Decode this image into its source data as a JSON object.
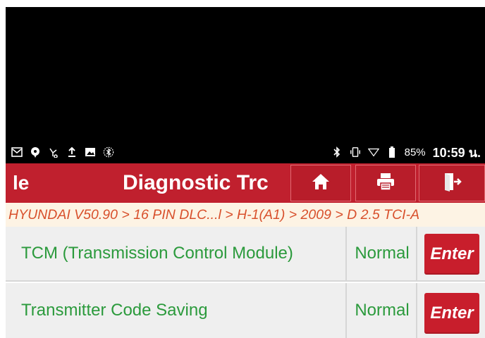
{
  "status_bar": {
    "battery_text": "85%",
    "time": "10:59 น.",
    "left_icons": [
      "gmail-icon",
      "chat-icon",
      "usb-debug-icon",
      "upload-icon",
      "image-icon",
      "bluetooth-scan-icon"
    ],
    "right_icons": [
      "bluetooth-icon",
      "vibrate-icon",
      "wifi-icon",
      "battery-icon"
    ]
  },
  "title_bar": {
    "back_label": "le",
    "title": "Diagnostic Trc",
    "buttons": [
      "home-icon",
      "print-icon",
      "exit-icon"
    ]
  },
  "breadcrumb": "HYUNDAI V50.90 > 16 PIN DLC...l > H-1(A1) > 2009 > D 2.5 TCI-A",
  "rows": [
    {
      "name": "TCM (Transmission Control Module)",
      "status": "Normal",
      "action": "Enter"
    },
    {
      "name": "Transmitter Code Saving",
      "status": "Normal",
      "action": "Enter"
    }
  ],
  "colors": {
    "header_red": "#c0202e",
    "enter_red": "#c81e2c",
    "text_green": "#2b9a3c",
    "breadcrumb_orange": "#d8502c",
    "breadcrumb_bg": "#fdf3e4"
  }
}
